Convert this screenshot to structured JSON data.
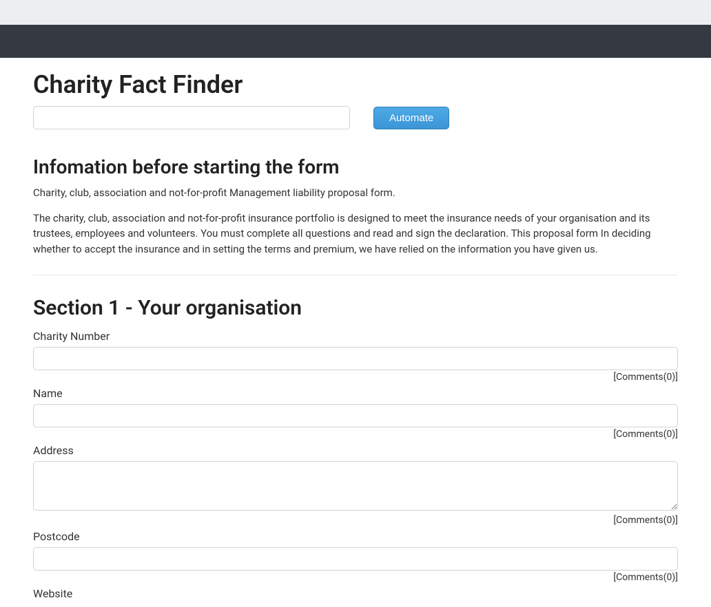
{
  "header": {
    "page_title": "Charity Fact Finder",
    "automate_button": "Automate",
    "search_value": ""
  },
  "info_section": {
    "heading": "Infomation before starting the form",
    "para1": "Charity, club, association and not-for-profit Management liability proposal form.",
    "para2": "The charity, club, association and not-for-profit insurance portfolio is designed to meet the insurance needs of your organisation and its trustees, employees and volunteers. You must complete all questions and read and sign the declaration. This proposal form In deciding whether to accept the insurance and in setting the terms and premium, we have relied on the information you have given us."
  },
  "section1": {
    "heading": "Section 1 - Your organisation",
    "fields": {
      "charity_number": {
        "label": "Charity Number",
        "value": "",
        "comments": "[Comments(0)]"
      },
      "name": {
        "label": "Name",
        "value": "",
        "comments": "[Comments(0)]"
      },
      "address": {
        "label": "Address",
        "value": "",
        "comments": "[Comments(0)]"
      },
      "postcode": {
        "label": "Postcode",
        "value": "",
        "comments": "[Comments(0)]"
      },
      "website": {
        "label": "Website",
        "value": ""
      }
    }
  }
}
